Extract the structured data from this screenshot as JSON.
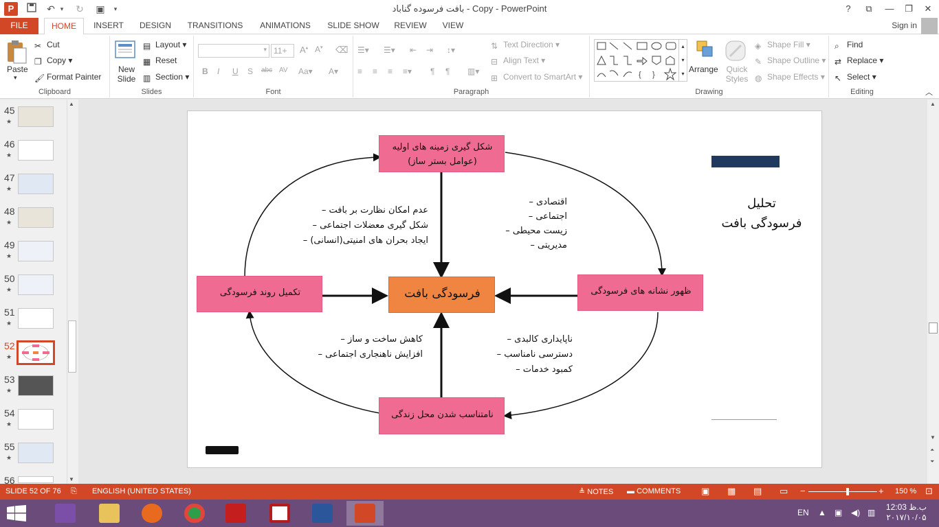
{
  "titlebar": {
    "title": "بافت فرسوده گناباد - Copy - PowerPoint",
    "app_icon": "P",
    "help": "?",
    "restore_ribbon": "⧉",
    "minimize": "—",
    "maximize": "❐",
    "close": "✕"
  },
  "tabs": {
    "file": "FILE",
    "home": "HOME",
    "insert": "INSERT",
    "design": "DESIGN",
    "transitions": "TRANSITIONS",
    "animations": "ANIMATIONS",
    "slideshow": "SLIDE SHOW",
    "review": "REVIEW",
    "view": "VIEW",
    "signin": "Sign in"
  },
  "ribbon": {
    "clipboard": {
      "paste": "Paste",
      "cut": "Cut",
      "copy": "Copy",
      "format_painter": "Format Painter",
      "label": "Clipboard"
    },
    "slides": {
      "new_slide": "New Slide",
      "layout": "Layout",
      "reset": "Reset",
      "section": "Section",
      "label": "Slides"
    },
    "font": {
      "size": "11+",
      "label": "Font"
    },
    "paragraph": {
      "text_direction": "Text Direction",
      "align_text": "Align Text",
      "smartart": "Convert to SmartArt",
      "label": "Paragraph"
    },
    "drawing": {
      "arrange": "Arrange",
      "quick_styles": "Quick Styles",
      "shape_fill": "Shape Fill",
      "shape_outline": "Shape Outline",
      "shape_effects": "Shape Effects",
      "label": "Drawing"
    },
    "editing": {
      "find": "Find",
      "replace": "Replace",
      "select": "Select",
      "label": "Editing"
    }
  },
  "thumbnails": [
    {
      "num": "45"
    },
    {
      "num": "46"
    },
    {
      "num": "47"
    },
    {
      "num": "48"
    },
    {
      "num": "49"
    },
    {
      "num": "50"
    },
    {
      "num": "51"
    },
    {
      "num": "52"
    },
    {
      "num": "53"
    },
    {
      "num": "54"
    },
    {
      "num": "55"
    },
    {
      "num": "56"
    }
  ],
  "slide": {
    "side_title_line1": "تحلیل",
    "side_title_line2": "فرسودگی بافت",
    "top_box_line1": "شکل گیری زمینه های اولیه",
    "top_box_line2": "(عوامل بستر ساز)",
    "right_box": "ظهور نشانه های فرسودگی",
    "left_box": "تکمیل روند فرسودگی",
    "bottom_box": "نامتناسب شدن محل زندگی",
    "center_box": "فرسودگی بافت",
    "list_top_left": [
      "عدم امکان نظارت بر بافت –",
      "شکل گیری معضلات اجتماعی –",
      "ایجاد بحران های امنیتی(انسانی) –"
    ],
    "list_top_right": [
      "اقتصادی –",
      "اجتماعی –",
      "زیست محیطی –",
      "مدیریتی –"
    ],
    "list_bottom_left": [
      "کاهش ساخت و ساز –",
      "افزایش ناهنجاری اجتماعی –"
    ],
    "list_bottom_right": [
      "ناپایداری کالبدی –",
      "دسترسی نامناسب –",
      "کمبود خدمات –"
    ]
  },
  "status": {
    "slide_count": "SLIDE 52 OF 76",
    "language": "ENGLISH (UNITED STATES)",
    "notes": "NOTES",
    "comments": "COMMENTS",
    "zoom": "150 %"
  },
  "taskbar": {
    "lang": "EN",
    "time": "12:03 ب.ظ",
    "date": "۲۰۱۷/۱۰/۰۵"
  },
  "colors": {
    "accent": "#d24726",
    "pink_box": "#f06b91",
    "orange_box": "#f08542",
    "navy_bar": "#1f3a5f"
  }
}
